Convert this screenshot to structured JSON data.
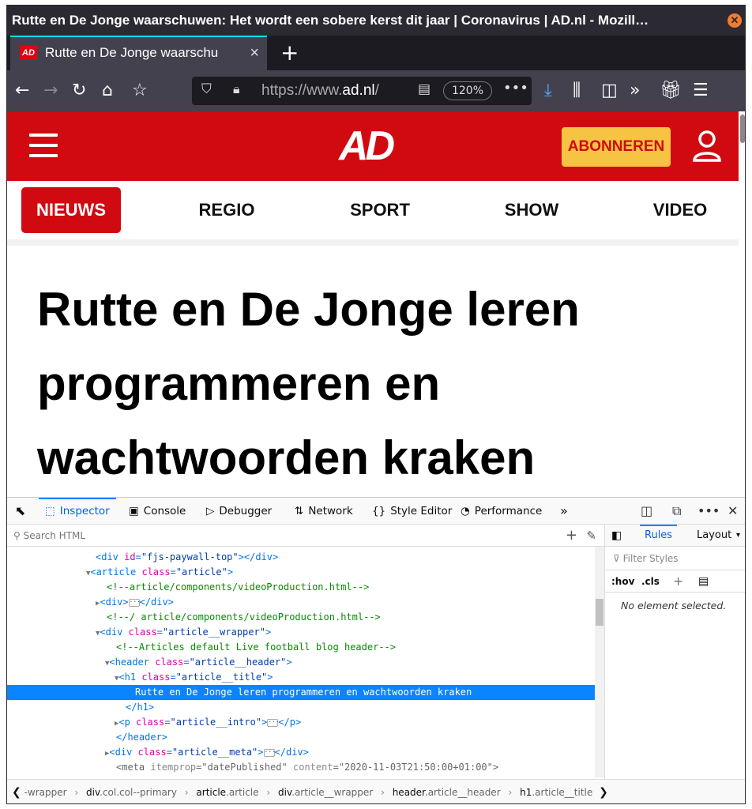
{
  "window": {
    "title": "Rutte en De Jonge waarschuwen: Het wordt een sobere kerst dit jaar | Coronavirus | AD.nl - Mozill…"
  },
  "tab": {
    "favicon": "AD",
    "label": "Rutte en De Jonge waarschu"
  },
  "navbar": {
    "url_prefix": "https://www.",
    "url_domain": "ad.nl",
    "url_suffix": "/",
    "zoom": "120%"
  },
  "site": {
    "logo": "AD",
    "subscribe_label": "ABONNEREN",
    "nav": [
      "NIEUWS",
      "REGIO",
      "SPORT",
      "SHOW",
      "VIDEO"
    ],
    "active_nav": "NIEUWS",
    "headline": "Rutte en De Jonge leren programmeren en wachtwoorden kraken",
    "brand_color": "#d10a11",
    "accent_color": "#f7c342"
  },
  "devtools": {
    "tabs": [
      "Inspector",
      "Console",
      "Debugger",
      "Network",
      "Style Editor",
      "Performance"
    ],
    "active_tab": "Inspector",
    "search_placeholder": "Search HTML",
    "side_tabs": [
      "Rules",
      "Layout"
    ],
    "filter_placeholder": "Filter Styles",
    "hov": ":hov",
    "cls": ".cls",
    "no_element": "No element selected.",
    "markup": {
      "l0_id_val": "\"fjs-paywall-top\"",
      "l1_class_val": "\"article\"",
      "l2_comment": "<!--article/components/videoProduction.html-->",
      "l4_comment": "<!--/ article/components/videoProduction.html-->",
      "l5_class_val": "\"article__wrapper\"",
      "l6_comment": "<!--Articles default Live football blog header-->",
      "l7_class_val": "\"article__header\"",
      "l8_class_val": "\"article__title\"",
      "l9_text": "Rutte en De Jonge leren programmeren en wachtwoorden kraken",
      "l11_class_val": "\"article__intro\"",
      "l13_class_val": "\"article__meta\"",
      "l14_attr1": "itemprop",
      "l14_val1": "\"datePublished\"",
      "l14_attr2": "content",
      "l14_val2": "\"2020-11-03T21:50:00+01:00\""
    },
    "breadcrumbs": [
      {
        "tag": "",
        "cls": "-wrapper"
      },
      {
        "tag": "div",
        "cls": ".col.col--primary"
      },
      {
        "tag": "article",
        "cls": ".article"
      },
      {
        "tag": "div",
        "cls": ".article__wrapper"
      },
      {
        "tag": "header",
        "cls": ".article__header"
      },
      {
        "tag": "h1",
        "cls": ".article__title"
      }
    ]
  }
}
